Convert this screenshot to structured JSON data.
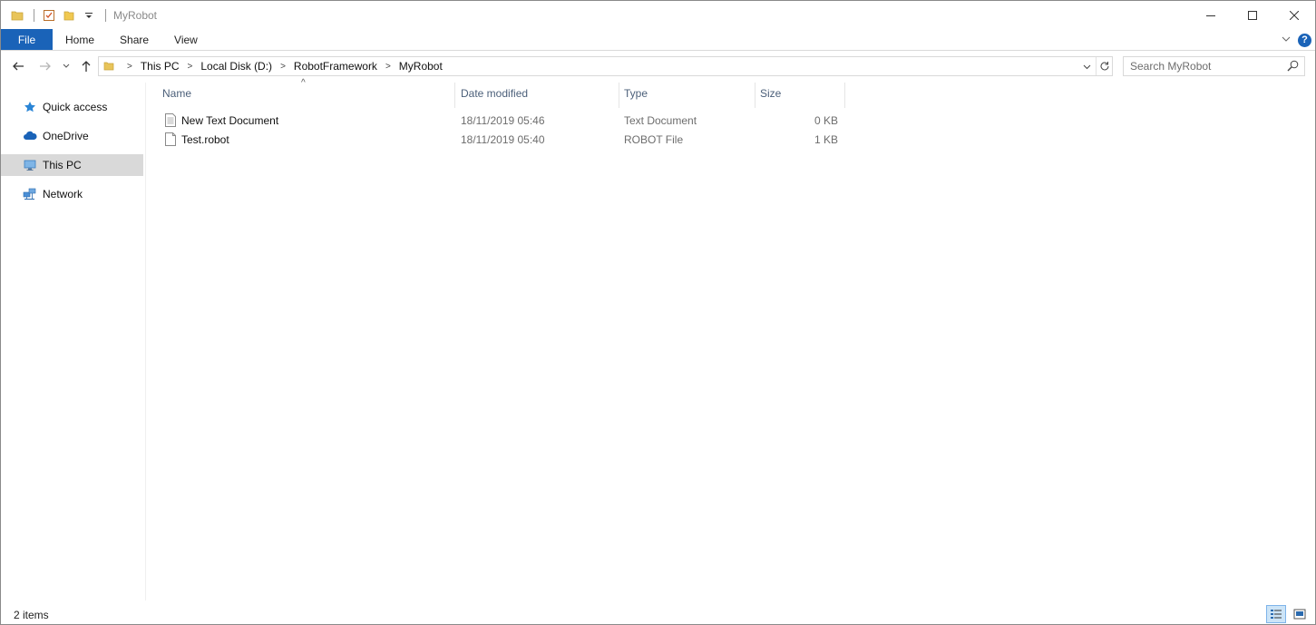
{
  "window": {
    "title": "MyRobot",
    "controls": {
      "minimize": "—",
      "maximize": "☐",
      "close": "✕"
    }
  },
  "ribbon": {
    "tabs": [
      "File",
      "Home",
      "Share",
      "View"
    ],
    "expand_glyph": "⌄",
    "help_glyph": "?"
  },
  "nav": {
    "back_glyph": "←",
    "forward_glyph": "→",
    "recent_glyph": "⌄",
    "up_glyph": "↑",
    "breadcrumb": [
      "This PC",
      "Local Disk (D:)",
      "RobotFramework",
      "MyRobot"
    ],
    "search_placeholder": "Search MyRobot"
  },
  "sidebar": {
    "items": [
      {
        "label": "Quick access",
        "icon": "star-icon"
      },
      {
        "label": "OneDrive",
        "icon": "cloud-icon"
      },
      {
        "label": "This PC",
        "icon": "computer-icon",
        "selected": true
      },
      {
        "label": "Network",
        "icon": "network-icon"
      }
    ]
  },
  "filelist": {
    "columns": [
      "Name",
      "Date modified",
      "Type",
      "Size"
    ],
    "sort_glyph": "^",
    "rows": [
      {
        "name": "New Text Document",
        "date": "18/11/2019 05:46",
        "type": "Text Document",
        "size": "0 KB",
        "icon": "text-file-icon"
      },
      {
        "name": "Test.robot",
        "date": "18/11/2019 05:40",
        "type": "ROBOT File",
        "size": "1 KB",
        "icon": "blank-file-icon"
      }
    ]
  },
  "status": {
    "item_count": "2 items"
  },
  "colors": {
    "accent": "#1a63b8",
    "selection": "#d9d9d9",
    "header_text": "#4c607a"
  }
}
